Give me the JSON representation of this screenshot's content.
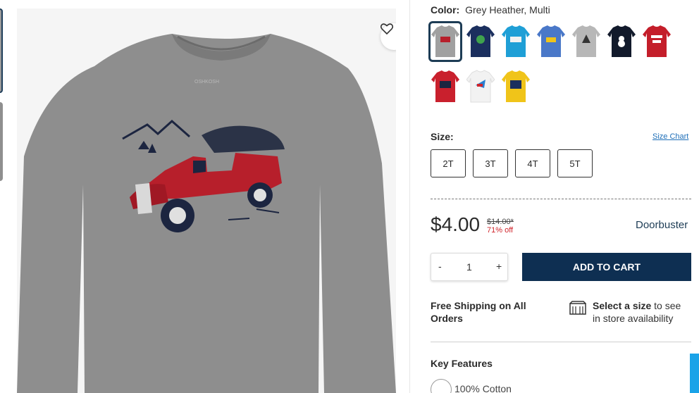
{
  "gallery": {
    "wishlist_icon": "heart-icon"
  },
  "product": {
    "color_label": "Color:",
    "color_value": "Grey Heather, Multi",
    "swatches": [
      {
        "name": "grey-firetruck",
        "color": "#9c9c9c",
        "selected": true
      },
      {
        "name": "navy-dino",
        "color": "#1b2f5e"
      },
      {
        "name": "teal-monster-truck",
        "color": "#1f9fd6"
      },
      {
        "name": "blue-truck",
        "color": "#4a78c8"
      },
      {
        "name": "grey-dino",
        "color": "#b7b7b7"
      },
      {
        "name": "black-snowman",
        "color": "#121a2b"
      },
      {
        "name": "red-worlds",
        "color": "#c41e2a"
      },
      {
        "name": "red-santa",
        "color": "#c9202d"
      },
      {
        "name": "white-graphic",
        "color": "#f2f2f2"
      },
      {
        "name": "yellow-graphic",
        "color": "#f0c419"
      }
    ],
    "size_label": "Size:",
    "size_chart": "Size Chart",
    "sizes": [
      "2T",
      "3T",
      "4T",
      "5T"
    ],
    "price": "$4.00",
    "original_price": "$14.00*",
    "discount": "71% off",
    "badge": "Doorbuster",
    "quantity": {
      "minus": "-",
      "value": "1",
      "plus": "+"
    },
    "add_to_cart": "ADD TO CART",
    "shipping": "Free Shipping on All Orders",
    "store_bold": "Select a size",
    "store_rest": " to see in store availability",
    "features_title": "Key Features",
    "feature_1": "100% Cotton"
  }
}
